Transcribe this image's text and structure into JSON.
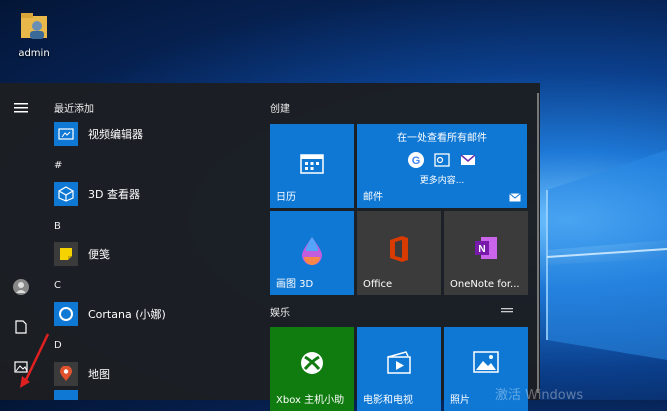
{
  "desktop": {
    "icon_label": "admin"
  },
  "start_menu": {
    "recently_added_title": "最近添加",
    "apps": [
      {
        "name": "视频编辑器"
      },
      {
        "letter": "#"
      },
      {
        "name": "3D 查看器"
      },
      {
        "letter": "B"
      },
      {
        "name": "便笺"
      },
      {
        "letter": "C"
      },
      {
        "name": "Cortana (小娜)"
      },
      {
        "letter": "D"
      },
      {
        "name": "地图"
      }
    ],
    "groups": [
      {
        "title": "创建"
      },
      {
        "title": "娱乐"
      }
    ],
    "tiles": {
      "calendar": "日历",
      "mail_header": "在一处查看所有邮件",
      "mail_more": "更多内容...",
      "mail": "邮件",
      "paint3d": "画图 3D",
      "office": "Office",
      "onenote": "OneNote for...",
      "xbox": "Xbox 主机小助",
      "movies": "电影和电视",
      "photos": "照片"
    }
  },
  "watermark": "激活 Windows",
  "colors": {
    "tile_blue": "#0f78d4",
    "tile_gray": "#3b3b3b",
    "tile_green": "#107c10",
    "office_red": "#d83b01",
    "onenote_purple": "#7719aa"
  }
}
